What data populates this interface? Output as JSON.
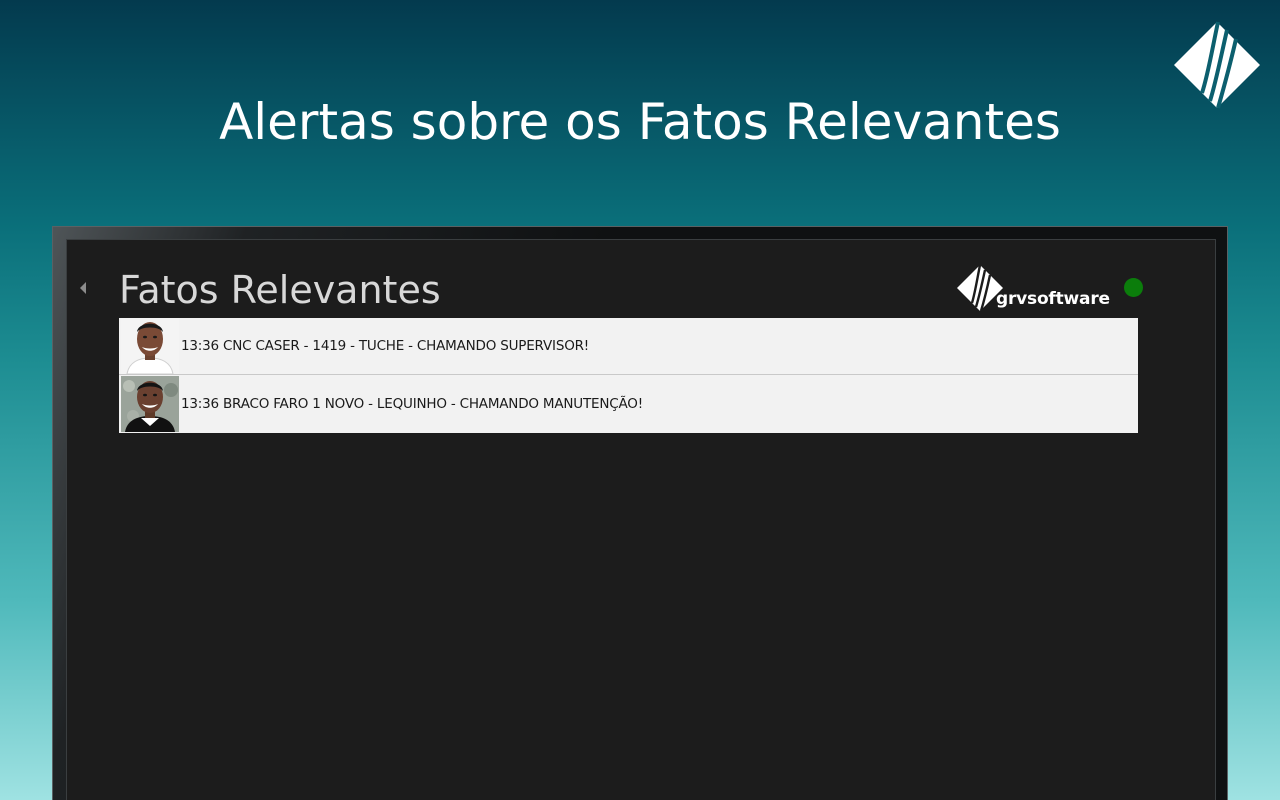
{
  "page": {
    "headline": "Alertas sobre os Fatos Relevantes"
  },
  "app": {
    "title": "Fatos Relevantes",
    "brand_name": "grvsoftware",
    "status_color": "#0b7d0b"
  },
  "alerts": [
    {
      "text": "13:36 CNC CASER - 1419 - TUCHE - CHAMANDO SUPERVISOR!",
      "avatar": "person-photo"
    },
    {
      "text": "13:36 BRACO FARO 1 NOVO - LEQUINHO - CHAMANDO MANUTENÇÃO!",
      "avatar": "person-photo"
    }
  ],
  "icons": {
    "back": "back-arrow-icon",
    "corner_logo": "grv-logo-icon",
    "brand_mark": "grv-logo-icon",
    "status": "status-indicator"
  }
}
